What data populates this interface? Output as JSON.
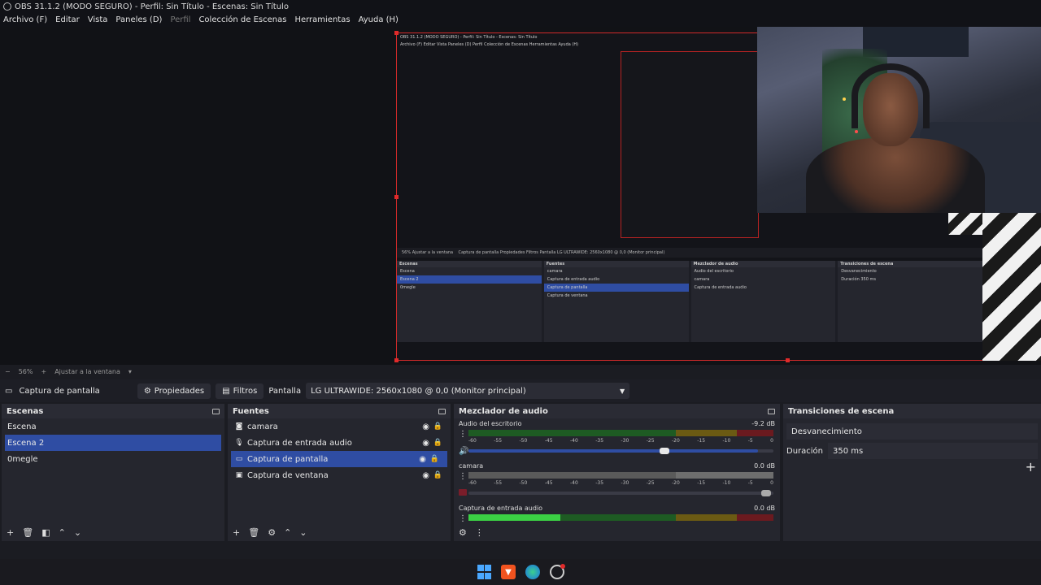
{
  "window": {
    "title": "OBS 31.1.2 (MODO SEGURO) - Perfil: Sin Título - Escenas: Sin Título"
  },
  "menu": [
    {
      "label": "Archivo (F)",
      "disabled": false
    },
    {
      "label": "Editar",
      "disabled": false
    },
    {
      "label": "Vista",
      "disabled": false
    },
    {
      "label": "Paneles (D)",
      "disabled": false
    },
    {
      "label": "Perfil",
      "disabled": true
    },
    {
      "label": "Colección de Escenas",
      "disabled": false
    },
    {
      "label": "Herramientas",
      "disabled": false
    },
    {
      "label": "Ayuda (H)",
      "disabled": false
    }
  ],
  "preview_status": {
    "zoom": "56%",
    "fit_label": "Ajustar a la ventana"
  },
  "toolbar": {
    "source_name": "Captura de pantalla",
    "properties_label": "Propiedades",
    "filters_label": "Filtros",
    "display_label": "Pantalla",
    "display_value": "LG ULTRAWIDE: 2560x1080 @ 0,0 (Monitor principal)"
  },
  "scenes": {
    "title": "Escenas",
    "items": [
      "Escena",
      "Escena 2",
      "0megle"
    ],
    "selected": 1
  },
  "sources": {
    "title": "Fuentes",
    "items": [
      {
        "label": "camara",
        "icon": "camera-icon"
      },
      {
        "label": "Captura de entrada audio",
        "icon": "microphone-icon"
      },
      {
        "label": "Captura de pantalla",
        "icon": "monitor-icon"
      },
      {
        "label": "Captura de ventana",
        "icon": "window-icon"
      }
    ],
    "selected": 2
  },
  "mixer": {
    "title": "Mezclador de audio",
    "scale": [
      "-60",
      "-55",
      "-50",
      "-45",
      "-40",
      "-35",
      "-30",
      "-25",
      "-20",
      "-15",
      "-10",
      "-5",
      "0"
    ],
    "channels": [
      {
        "name": "Audio del escritorio",
        "db": "-9.2 dB",
        "level": 0.0,
        "fader": 1.0
      },
      {
        "name": "camara",
        "db": "0.0 dB",
        "level": 0.0,
        "fader": 1.0
      },
      {
        "name": "Captura de entrada audio",
        "db": "0.0 dB",
        "level": 0.3,
        "fader": 1.0
      }
    ]
  },
  "transitions": {
    "title": "Transiciones de escena",
    "type": "Desvanecimiento",
    "duration_label": "Duración",
    "duration_value": "350 ms"
  },
  "nested": {
    "title": "OBS 31.1.2 (MODO SEGURO) - Perfil: Sin Título - Escenas: Sin Título",
    "menu": "Archivo (F)  Editar  Vista  Paneles (D)  Perfil  Colección de Escenas  Herramientas  Ayuda (H)",
    "bar": "56%   Ajustar a la ventana",
    "toolbar": "Captura de pantalla   Propiedades   Filtros   Pantalla   LG ULTRAWIDE: 2560x1080 @ 0,0 (Monitor principal)",
    "scenes": [
      "Escenas",
      "Escena",
      "Escena 2",
      "0megle"
    ],
    "sources": [
      "Fuentes",
      "camara",
      "Captura de entrada audio",
      "Captura de pantalla",
      "Captura de ventana"
    ],
    "mixer": [
      "Mezclador de audio",
      "Audio del escritorio",
      "camara",
      "Captura de entrada audio"
    ],
    "transitions": [
      "Transiciones de escena",
      "Desvanecimiento",
      "Duración",
      "350 ms"
    ]
  },
  "colors": {
    "accent": "#2f4da3",
    "selection_border": "#d12a2a",
    "meter_green": "#3bd044"
  }
}
